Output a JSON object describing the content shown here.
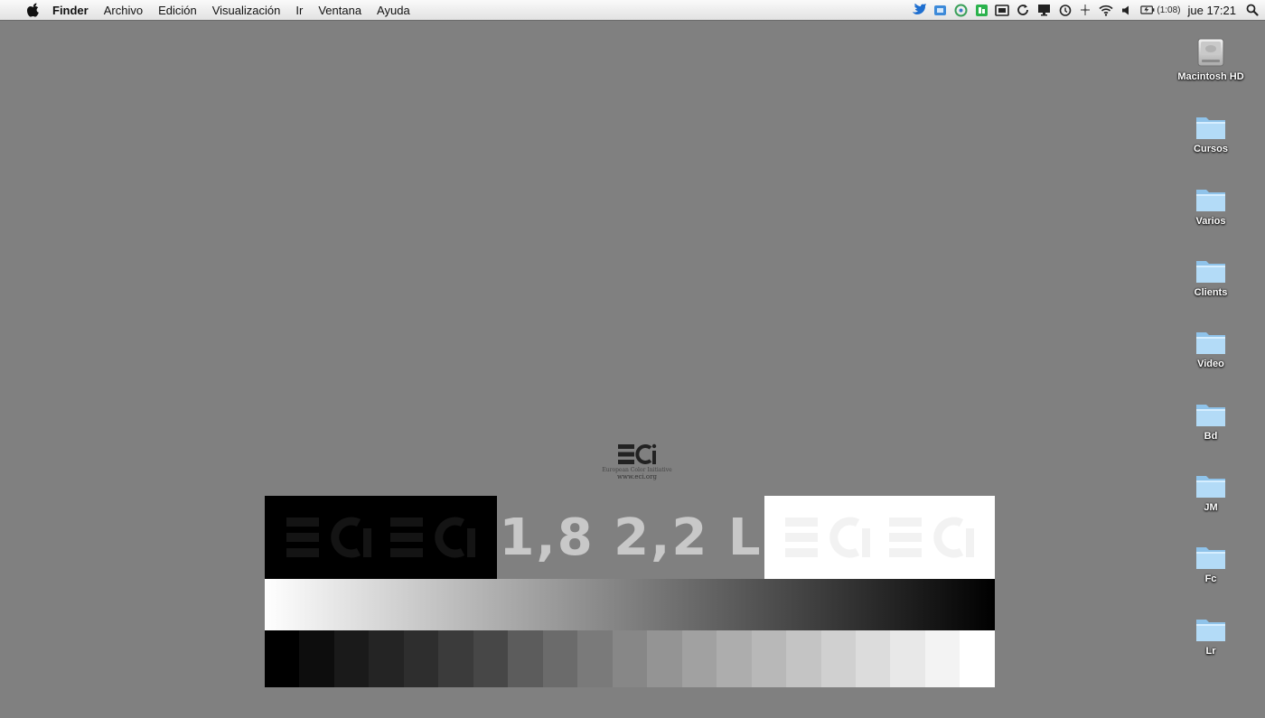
{
  "menubar": {
    "app_name": "Finder",
    "menus": [
      "Archivo",
      "Edición",
      "Visualización",
      "Ir",
      "Ventana",
      "Ayuda"
    ],
    "status_icons": [
      "twitter-bird-icon",
      "dropbox-icon",
      "sync-icon",
      "evernote-icon",
      "screen-capture-icon",
      "refresh-icon",
      "display-icon",
      "time-machine-icon",
      "bluetooth-icon",
      "wifi-icon",
      "volume-icon",
      "battery-icon"
    ],
    "battery_time": "(1:08)",
    "clock": "jue 17:21"
  },
  "desktop": {
    "icons": [
      {
        "label": "Macintosh HD",
        "icon": "hard-drive-icon"
      },
      {
        "label": "Cursos",
        "icon": "folder-icon"
      },
      {
        "label": "Varios",
        "icon": "folder-icon"
      },
      {
        "label": "Clients",
        "icon": "folder-icon"
      },
      {
        "label": "Video",
        "icon": "folder-icon"
      },
      {
        "label": "Bd",
        "icon": "folder-icon"
      },
      {
        "label": "JM",
        "icon": "folder-icon"
      },
      {
        "label": "Fc",
        "icon": "folder-icon"
      },
      {
        "label": "Lr",
        "icon": "folder-icon"
      }
    ]
  },
  "wallpaper": {
    "logo_text": "ECI",
    "logo_tagline": "European Color Initiative",
    "logo_url": "www.eci.org",
    "gamma_label": "1,8 2,2 L",
    "step_wedge": [
      "#000000",
      "#0d0d0d",
      "#1a1a1a",
      "#242424",
      "#2e2e2e",
      "#3b3b3b",
      "#474747",
      "#5c5c5c",
      "#6b6b6b",
      "#7a7a7a",
      "#878787",
      "#949494",
      "#a1a1a1",
      "#adadad",
      "#b8b8b8",
      "#c4c4c4",
      "#d0d0d0",
      "#dcdcdc",
      "#e8e8e8",
      "#f3f3f3",
      "#ffffff"
    ],
    "colors": {
      "background": "#808080",
      "black": "#000000",
      "white": "#ffffff"
    }
  }
}
